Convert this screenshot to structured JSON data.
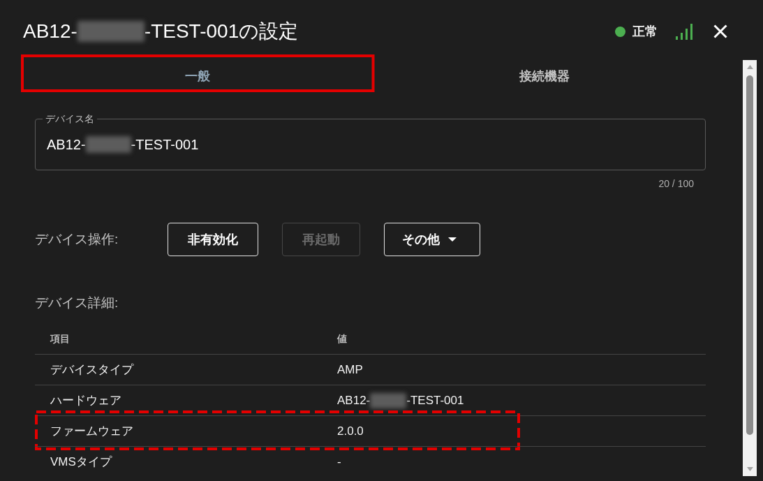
{
  "window": {
    "title": [
      {
        "kind": "text",
        "text": "AB12-"
      },
      {
        "kind": "redacted"
      },
      {
        "kind": "text",
        "text": "-TEST-001の設定"
      }
    ],
    "status": {
      "label": "正常",
      "color": "#4caf50"
    }
  },
  "tabs": [
    {
      "label": "一般",
      "selected": true,
      "highlighted": true
    },
    {
      "label": "接続機器",
      "selected": false,
      "highlighted": false
    }
  ],
  "device_name": {
    "label": "デバイス名",
    "value": [
      {
        "kind": "text",
        "text": "AB12-"
      },
      {
        "kind": "redacted"
      },
      {
        "kind": "text",
        "text": "-TEST-001"
      }
    ],
    "counter": "20 / 100"
  },
  "device_actions": {
    "label": "デバイス操作:",
    "buttons": [
      {
        "label": "非有効化",
        "kind": "plain",
        "disabled": false
      },
      {
        "label": "再起動",
        "kind": "plain",
        "disabled": true
      },
      {
        "label": "その他",
        "kind": "dropdown",
        "disabled": false
      }
    ]
  },
  "device_details": {
    "label": "デバイス詳細:",
    "columns": [
      "項目",
      "値"
    ],
    "rows": [
      {
        "item": "デバイスタイプ",
        "value": [
          {
            "kind": "text",
            "text": "AMP"
          }
        ],
        "highlighted": false
      },
      {
        "item": "ハードウェア",
        "value": [
          {
            "kind": "text",
            "text": "AB12-"
          },
          {
            "kind": "redacted"
          },
          {
            "kind": "text",
            "text": "-TEST-001"
          }
        ],
        "highlighted": false
      },
      {
        "item": "ファームウェア",
        "value": [
          {
            "kind": "text",
            "text": "2.0.0"
          }
        ],
        "highlighted": true
      },
      {
        "item": "VMSタイプ",
        "value": [
          {
            "kind": "text",
            "text": "-"
          }
        ],
        "highlighted": false
      }
    ]
  }
}
